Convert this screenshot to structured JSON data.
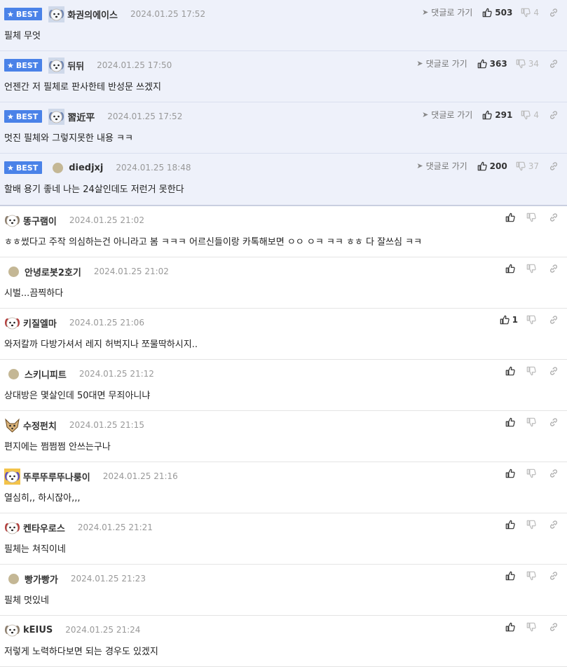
{
  "ui": {
    "best_label": "BEST",
    "goto_label": "댓글로 가기"
  },
  "best": [
    {
      "nick": "화권의에이스",
      "date": "2024.01.25 17:52",
      "text": "필체 무엇",
      "up": "503",
      "down": "4",
      "avatar": "photo"
    },
    {
      "nick": "뒤뒤",
      "date": "2024.01.25 17:50",
      "text": "언젠간 저 필체로 판사한테 반성문 쓰겠지",
      "up": "363",
      "down": "34",
      "avatar": "photo"
    },
    {
      "nick": "習近平",
      "date": "2024.01.25 17:52",
      "text": "멋진 필체와 그렇지못한 내용 ㅋㅋ",
      "up": "291",
      "down": "4",
      "avatar": "photo"
    },
    {
      "nick": "diedjxj",
      "date": "2024.01.25 18:48",
      "text": "할배 용기 좋네 나는 24살인데도 저런거 못한다",
      "up": "200",
      "down": "37",
      "avatar": "dot"
    }
  ],
  "comments": [
    {
      "nick": "똥구램이",
      "date": "2024.01.25 21:02",
      "text": "ㅎㅎ썼다고 주작 의심하는건 아니라고 봄 ㅋㅋㅋ 어르신들이랑 카톡해보면 ㅇㅇ ㅇㅋ ㅋㅋ ㅎㅎ 다 잘쓰심 ㅋㅋ",
      "up": "",
      "avatar": "dog"
    },
    {
      "nick": "안녕로봇2호기",
      "date": "2024.01.25 21:02",
      "text": "시벌...끔찍하다",
      "up": "",
      "avatar": "dot"
    },
    {
      "nick": "키질엘마",
      "date": "2024.01.25 21:06",
      "text": "와저칼까 다방가셔서 레지 허벅지나 쪼물딱하시지..",
      "up": "1",
      "avatar": "dog-red"
    },
    {
      "nick": "스키니피트",
      "date": "2024.01.25 21:12",
      "text": "상대방은 몇살인데 50대면 무죄아니냐",
      "up": "",
      "avatar": "dot"
    },
    {
      "nick": "수정펀치",
      "date": "2024.01.25 21:15",
      "text": "편지에는 쩜쩜쩜 안쓰는구나",
      "up": "",
      "avatar": "fox"
    },
    {
      "nick": "뚜루뚜루뚜나룽이",
      "date": "2024.01.25 21:16",
      "text": "열심히,, 하시잖아,,,",
      "up": "",
      "avatar": "dog-color"
    },
    {
      "nick": "켄타우로스",
      "date": "2024.01.25 21:21",
      "text": "필체는 쳐직이네",
      "up": "",
      "avatar": "dog-red"
    },
    {
      "nick": "빵가빵가",
      "date": "2024.01.25 21:23",
      "text": "필체 멋있네",
      "up": "",
      "avatar": "dot"
    },
    {
      "nick": "kEIUS",
      "date": "2024.01.25 21:24",
      "text": "저렇게 노력하다보면 되는 경우도 있겠지",
      "up": "",
      "avatar": "dog"
    }
  ]
}
